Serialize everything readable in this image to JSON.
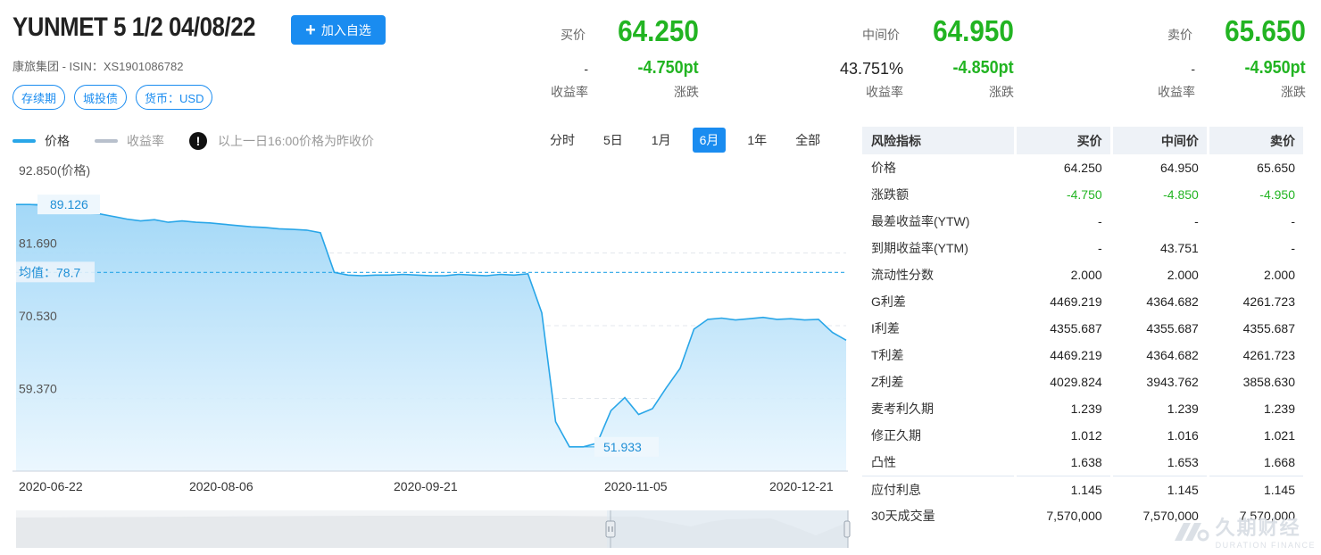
{
  "header": {
    "title": "YUNMET 5 1/2 04/08/22",
    "add_button": "加入自选",
    "subtitle": "康旅集团 - ISIN：XS1901086782",
    "tags": [
      "存续期",
      "城投债",
      "货币：USD"
    ]
  },
  "quotes": {
    "bid": {
      "label": "买价",
      "price": "64.250",
      "yield_value": "-",
      "yield_label": "收益率",
      "change": "-4.750pt",
      "change_label": "涨跌"
    },
    "mid": {
      "label": "中间价",
      "price": "64.950",
      "yield_value": "43.751%",
      "yield_label": "收益率",
      "change": "-4.850pt",
      "change_label": "涨跌"
    },
    "ask": {
      "label": "卖价",
      "price": "65.650",
      "yield_value": "-",
      "yield_label": "收益率",
      "change": "-4.950pt",
      "change_label": "涨跌"
    }
  },
  "legend": {
    "price": "价格",
    "yield": "收益率",
    "note": "以上一日16:00价格为昨收价",
    "info_icon": "exclamation-icon"
  },
  "ranges": {
    "items": [
      "分时",
      "5日",
      "1月",
      "6月",
      "1年",
      "全部"
    ],
    "active": "6月"
  },
  "chart_data": {
    "type": "area",
    "x_labels": [
      "2020-06-22",
      "2020-08-06",
      "2020-09-21",
      "2020-11-05",
      "2020-12-21"
    ],
    "y_ticks": [
      "92.850(价格)",
      "81.690",
      "70.530",
      "59.370"
    ],
    "y_tick_values": [
      92.85,
      81.69,
      70.53,
      59.37
    ],
    "ylim": [
      48.21,
      92.85
    ],
    "series": [
      {
        "values": [
          89.13,
          89.13,
          89.0,
          88.6,
          88.3,
          87.8,
          87.7,
          87.3,
          86.9,
          86.6,
          86.8,
          86.4,
          86.6,
          86.4,
          86.3,
          86.1,
          85.9,
          85.7,
          85.6,
          85.4,
          85.3,
          85.2,
          84.8,
          78.7,
          78.3,
          78.2,
          78.3,
          78.3,
          78.4,
          78.3,
          78.2,
          78.2,
          78.4,
          78.3,
          78.2,
          78.4,
          78.3,
          78.5,
          72.5,
          55.8,
          51.93,
          51.93,
          52.5,
          57.5,
          59.5,
          56.9,
          57.8,
          61.0,
          64.0,
          70.0,
          71.5,
          71.7,
          71.4,
          71.6,
          71.8,
          71.5,
          71.6,
          71.4,
          71.5,
          69.5,
          68.3
        ]
      }
    ],
    "average": {
      "label": "均值：78.7",
      "value": 78.7
    },
    "annotations": {
      "max": "89.126",
      "min": "51.933"
    }
  },
  "risk_table": {
    "headers": [
      "风险指标",
      "买价",
      "中间价",
      "卖价"
    ],
    "rows": [
      {
        "label": "价格",
        "bid": "64.250",
        "mid": "64.950",
        "ask": "65.650",
        "neg": false
      },
      {
        "label": "涨跌额",
        "bid": "-4.750",
        "mid": "-4.850",
        "ask": "-4.950",
        "neg": true
      },
      {
        "label": "最差收益率(YTW)",
        "bid": "-",
        "mid": "-",
        "ask": "-",
        "neg": false
      },
      {
        "label": "到期收益率(YTM)",
        "bid": "-",
        "mid": "43.751",
        "ask": "-",
        "neg": false
      },
      {
        "label": "流动性分数",
        "bid": "2.000",
        "mid": "2.000",
        "ask": "2.000",
        "neg": false
      },
      {
        "label": "G利差",
        "bid": "4469.219",
        "mid": "4364.682",
        "ask": "4261.723",
        "neg": false
      },
      {
        "label": "I利差",
        "bid": "4355.687",
        "mid": "4355.687",
        "ask": "4355.687",
        "neg": false
      },
      {
        "label": "T利差",
        "bid": "4469.219",
        "mid": "4364.682",
        "ask": "4261.723",
        "neg": false
      },
      {
        "label": "Z利差",
        "bid": "4029.824",
        "mid": "3943.762",
        "ask": "3858.630",
        "neg": false
      },
      {
        "label": "麦考利久期",
        "bid": "1.239",
        "mid": "1.239",
        "ask": "1.239",
        "neg": false
      },
      {
        "label": "修正久期",
        "bid": "1.012",
        "mid": "1.016",
        "ask": "1.021",
        "neg": false
      },
      {
        "label": "凸性",
        "bid": "1.638",
        "mid": "1.653",
        "ask": "1.668",
        "neg": false
      },
      {
        "label": "应付利息",
        "bid": "1.145",
        "mid": "1.145",
        "ask": "1.145",
        "neg": false
      },
      {
        "label": "30天成交量",
        "bid": "7,570,000",
        "mid": "7,570,000",
        "ask": "7,570,000",
        "neg": false
      }
    ]
  },
  "watermark": {
    "cn": "久期财经",
    "en": "DURATION FINANCE"
  },
  "colors": {
    "accent": "#1a8cf0",
    "negative": "#22b422",
    "price_line": "#29a6e8",
    "yield_line": "#b8c0cc"
  }
}
